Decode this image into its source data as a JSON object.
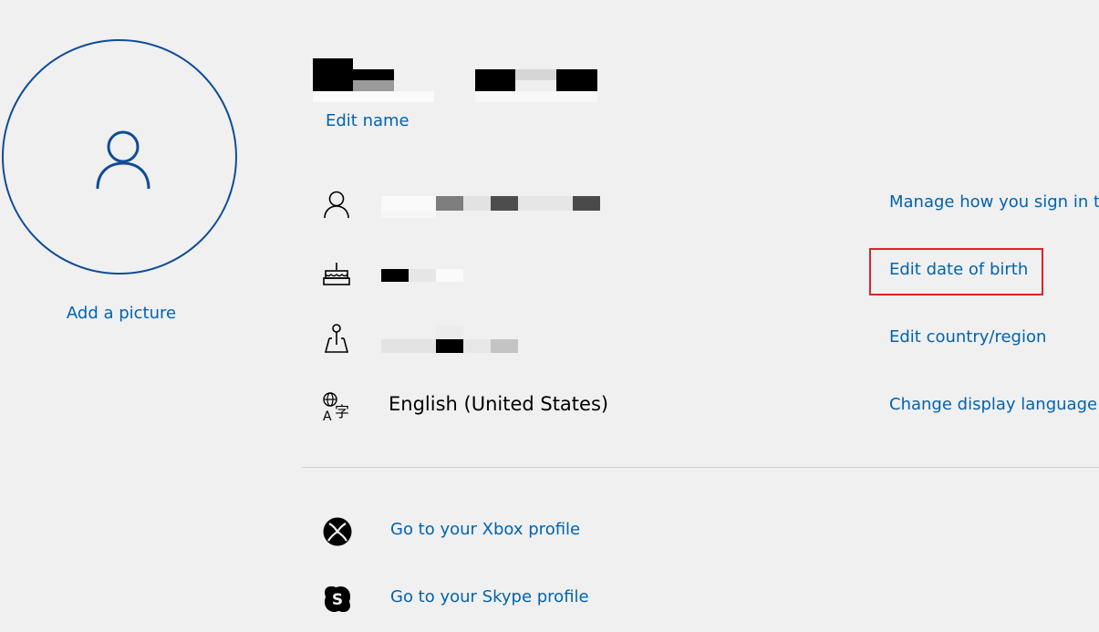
{
  "profile": {
    "add_picture_label": "Add a picture",
    "edit_name_label": "Edit name",
    "avatar_icon": "person-icon"
  },
  "rows": [
    {
      "icon": "person-icon",
      "link_label": "Manage how you sign in to"
    },
    {
      "icon": "cake-icon",
      "link_label": "Edit date of birth"
    },
    {
      "icon": "map-pin-icon",
      "link_label": "Edit country/region"
    },
    {
      "icon": "language-icon",
      "value": "English (United States)",
      "link_label": "Change display language"
    }
  ],
  "links": {
    "xbox": "Go to your Xbox profile",
    "skype": "Go to your Skype profile"
  },
  "colors": {
    "link": "#0063b1",
    "avatar_border": "#0f4c97",
    "highlight": "#e0222a",
    "background": "#f0f0f0"
  }
}
